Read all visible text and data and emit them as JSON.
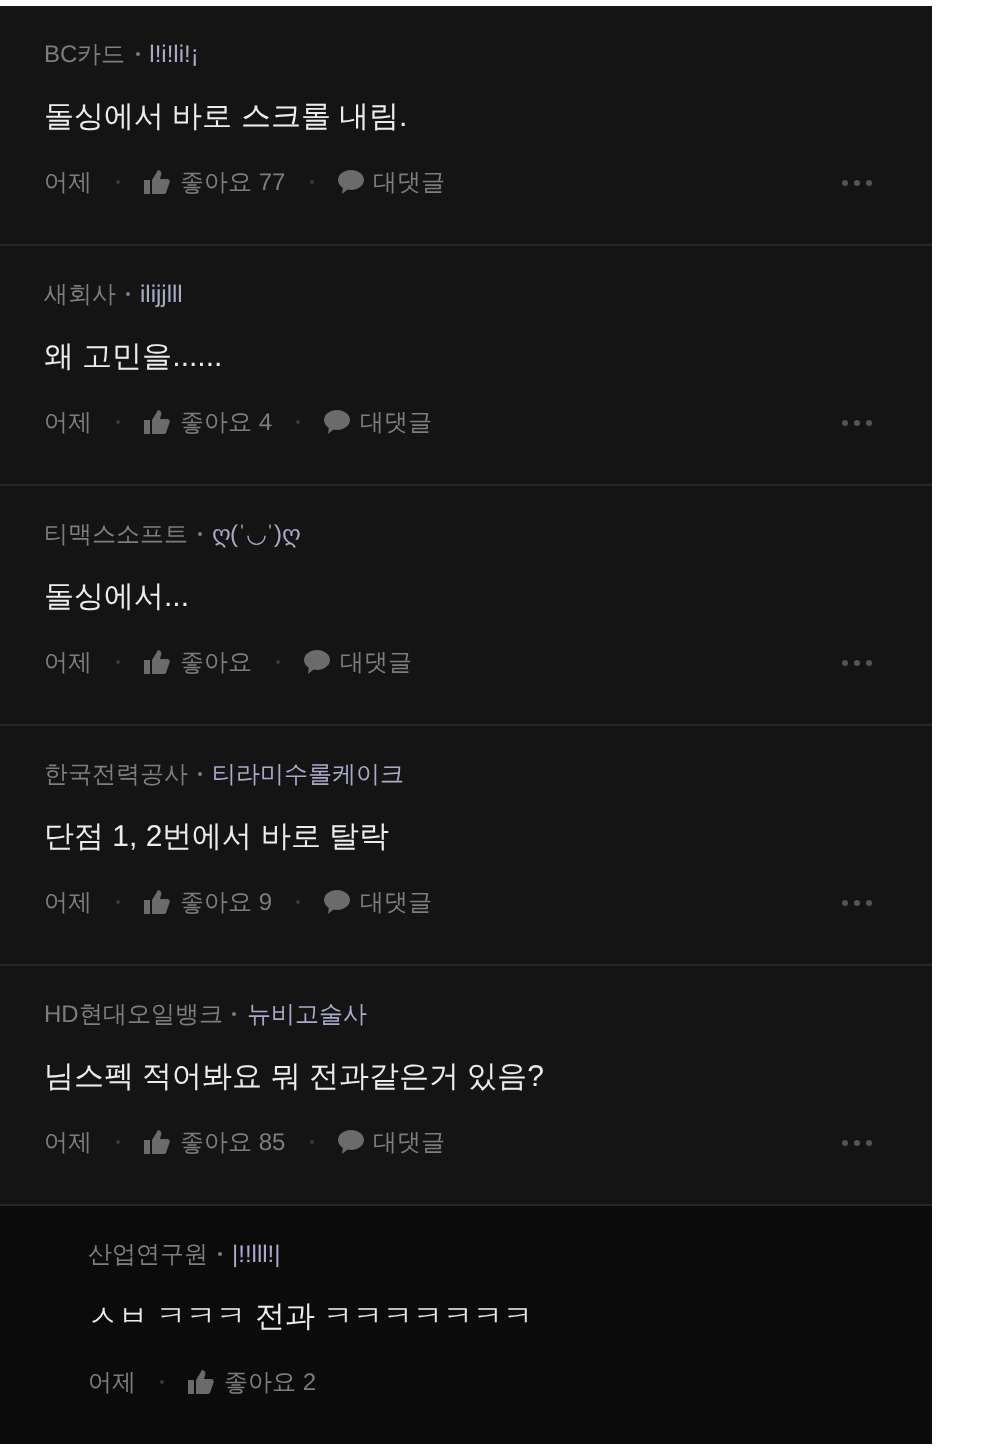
{
  "comments": [
    {
      "kind": "comment",
      "company": "BC카드",
      "nickname": "l!i!li!¡",
      "text": "돌싱에서 바로 스크롤 내림.",
      "time": "어제",
      "likes": "좋아요 77",
      "reply": "대댓글"
    },
    {
      "kind": "comment",
      "company": "새회사",
      "nickname": "ilijjlll",
      "text": "왜 고민을......",
      "time": "어제",
      "likes": "좋아요 4",
      "reply": "대댓글"
    },
    {
      "kind": "comment",
      "company": "티맥스소프트",
      "nickname": "ღ(ˈ◡ˈ)ღ",
      "text": "돌싱에서...",
      "time": "어제",
      "likes": "좋아요",
      "reply": "대댓글"
    },
    {
      "kind": "comment",
      "company": "한국전력공사",
      "nickname": "티라미수롤케이크",
      "text": "단점 1, 2번에서 바로 탈락",
      "time": "어제",
      "likes": "좋아요 9",
      "reply": "대댓글"
    },
    {
      "kind": "comment",
      "company": "HD현대오일뱅크",
      "nickname": "뉴비고술사",
      "text": "님스펙 적어봐요 뭐 전과같은거 있음?",
      "time": "어제",
      "likes": "좋아요 85",
      "reply": "대댓글"
    },
    {
      "kind": "reply",
      "company": "산업연구원",
      "nickname": "|!!lll!|",
      "text": "ㅅㅂ ㅋㅋㅋ 전과 ㅋㅋㅋㅋㅋㅋㅋ",
      "time": "어제",
      "likes": "좋아요 2"
    }
  ]
}
